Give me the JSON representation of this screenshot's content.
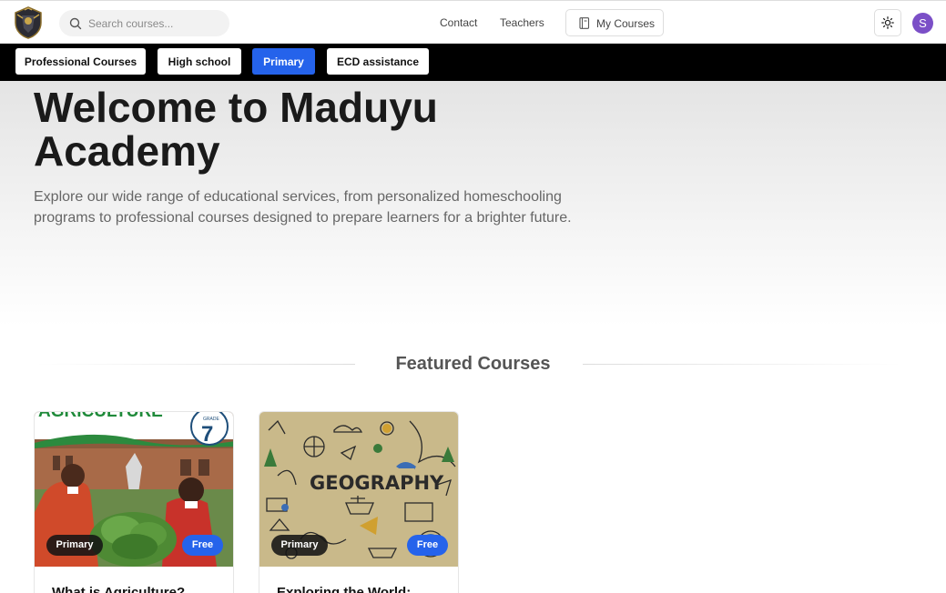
{
  "header": {
    "search": {
      "placeholder": "Search courses..."
    },
    "nav": [
      {
        "label": "Contact"
      },
      {
        "label": "Teachers"
      }
    ],
    "my_courses_label": "My Courses",
    "avatar_initial": "S"
  },
  "categories": [
    {
      "label": "Professional Courses",
      "active": false
    },
    {
      "label": "High school",
      "active": false
    },
    {
      "label": "Primary",
      "active": true
    },
    {
      "label": "ECD assistance",
      "active": false
    }
  ],
  "hero": {
    "title": "Welcome to Maduyu Academy",
    "subtitle": "Explore our wide range of educational services, from personalized homeschooling programs to professional courses designed to prepare learners for a brighter future."
  },
  "featured": {
    "title": "Featured Courses",
    "courses": [
      {
        "title": "What is Agriculture?",
        "level": "Primary",
        "price": "Free",
        "thumb_banner": "AGRICULTURE",
        "thumb_grade_label": "GRADE",
        "thumb_grade": "7"
      },
      {
        "title": "Exploring the World:",
        "level": "Primary",
        "price": "Free",
        "thumb_text": "GEOGRAPHY"
      }
    ]
  },
  "colors": {
    "accent": "#2563eb",
    "catbar": "#000000",
    "avatar": "#7b4fc7"
  },
  "icons": {
    "search": "search-icon",
    "my_courses": "book-icon",
    "theme": "sun-icon",
    "logo": "crest-logo-icon"
  }
}
